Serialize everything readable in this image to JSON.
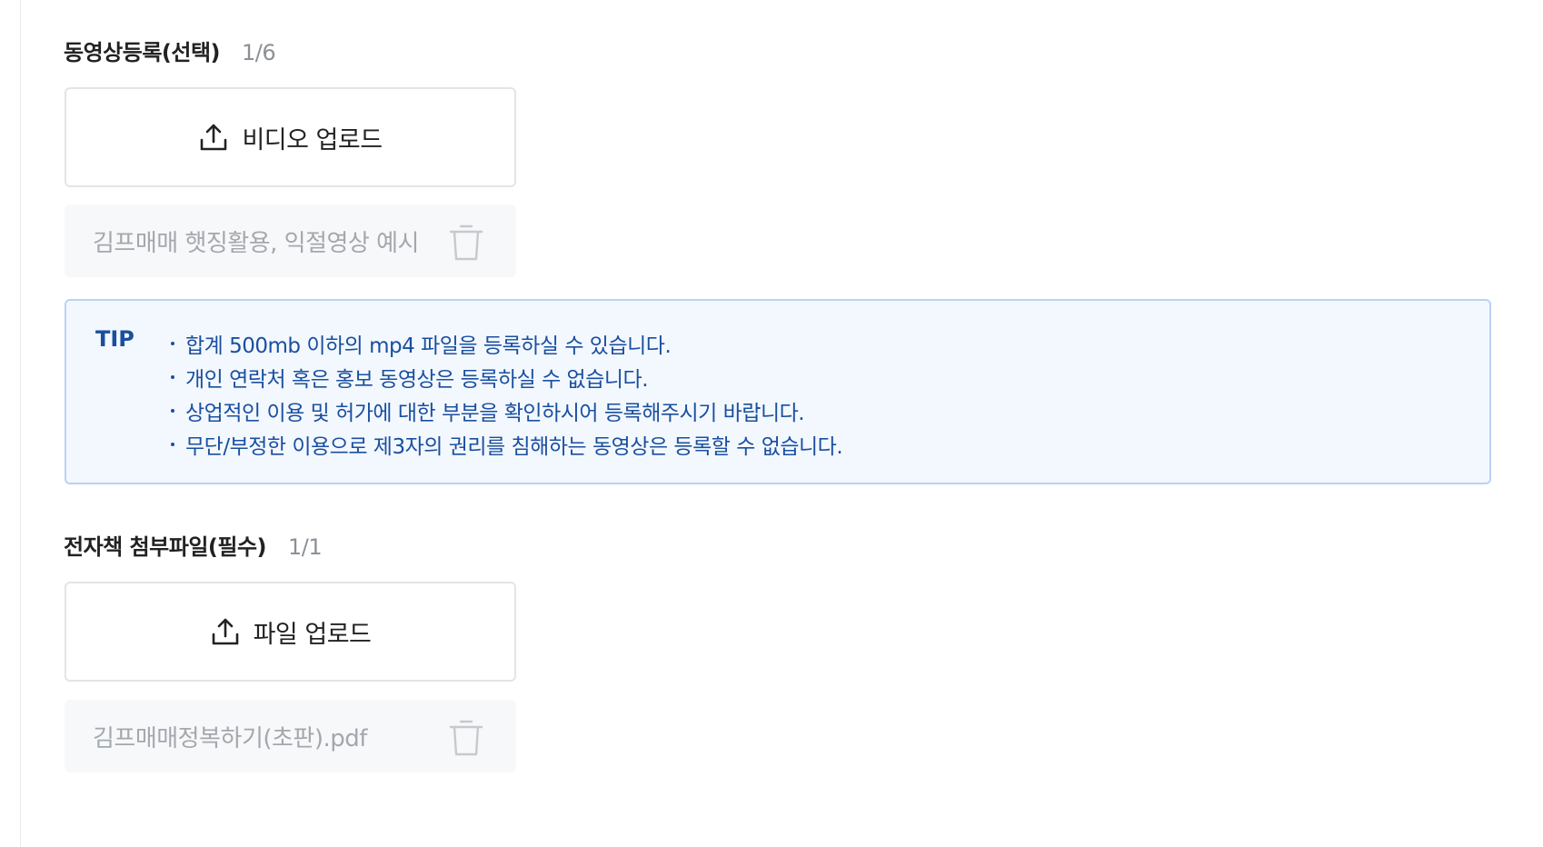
{
  "video_section": {
    "title": "동영상등록(선택)",
    "count": "1/6",
    "upload_label": "비디오 업로드",
    "file_name": "김프매매 햇징활용, 익절영상 예시"
  },
  "tip": {
    "label": "TIP",
    "items": [
      "합계 500mb 이하의 mp4 파일을 등록하실 수 있습니다.",
      "개인 연락처 혹은 홍보 동영상은 등록하실 수 없습니다.",
      "상업적인 이용 및 허가에 대한 부분을 확인하시어 등록해주시기 바랍니다.",
      "무단/부정한 이용으로 제3자의 권리를 침해하는 동영상은 등록할 수 없습니다."
    ]
  },
  "ebook_section": {
    "title": "전자책 첨부파일(필수)",
    "count": "1/1",
    "upload_label": "파일 업로드",
    "file_name": "김프매매정복하기(초판).pdf"
  },
  "icons": {
    "upload": "upload-icon",
    "delete": "trash-icon"
  },
  "colors": {
    "tip_text": "#1a4fa0",
    "tip_background": "#f3f8fe",
    "tip_border": "#b9d3f5",
    "muted_text": "#a3a8ae"
  }
}
